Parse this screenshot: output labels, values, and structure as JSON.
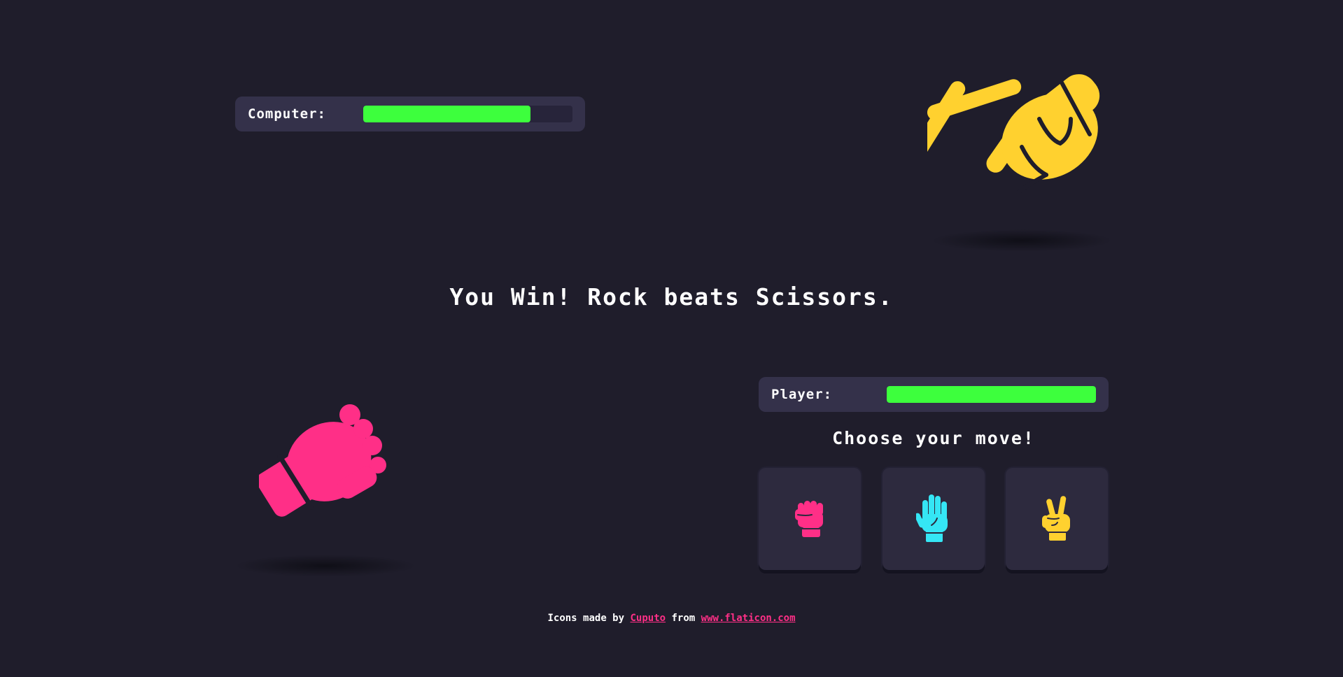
{
  "computer": {
    "label": "Computer:",
    "health_percent": 80,
    "played_move_icon": "scissors-hand-icon"
  },
  "player": {
    "label": "Player:",
    "health_percent": 100,
    "played_move_icon": "rock-fist-icon"
  },
  "result": {
    "text": "You Win! Rock beats Scissors."
  },
  "moves": {
    "prompt": "Choose your move!",
    "items": [
      {
        "name": "rock",
        "icon": "fist-icon",
        "color": "#ff2f87"
      },
      {
        "name": "paper",
        "icon": "open-hand-icon",
        "color": "#35e6f5"
      },
      {
        "name": "scissors",
        "icon": "peace-hand-icon",
        "color": "#ffd12f"
      }
    ]
  },
  "footer": {
    "prefix": "Icons made by",
    "author_link": "Cuputo",
    "middle": "from",
    "site_link": "www.flaticon.com"
  },
  "colors": {
    "background": "#1f1d2b",
    "panel": "#34314a",
    "health": "#3dff3d",
    "rock": "#ff2f87",
    "paper": "#35e6f5",
    "scissors": "#ffd12f"
  }
}
